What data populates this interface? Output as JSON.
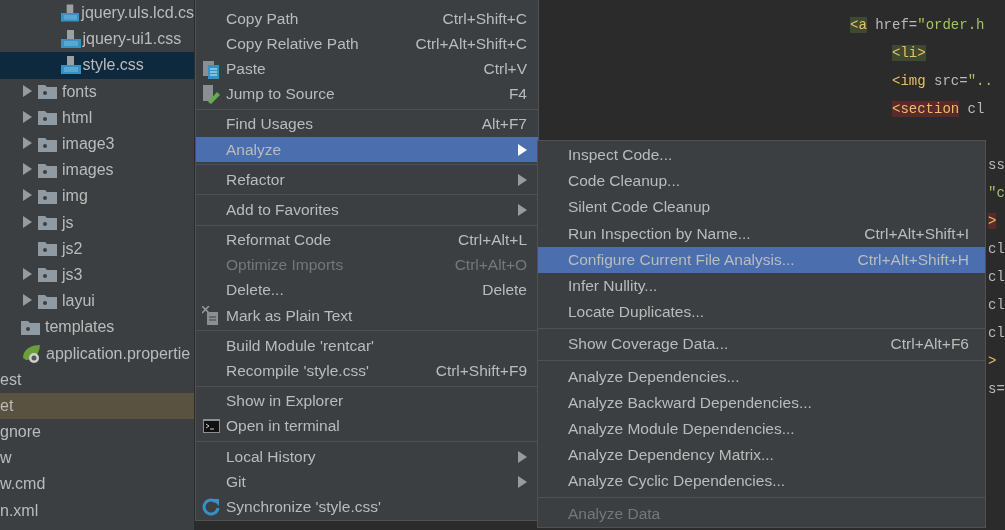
{
  "project_tree": [
    {
      "children": [
        {
          "children": [
            {
              "children": [
                {
                  "label": "jquery.uls.lcd.cs",
                  "kind": "css",
                  "selected": false,
                  "highlighted": false
                },
                {
                  "label": "jquery-ui1.css",
                  "kind": "css",
                  "selected": false,
                  "highlighted": false
                },
                {
                  "label": "style.css",
                  "kind": "css",
                  "selected": true,
                  "highlighted": false
                }
              ]
            },
            {
              "label": "fonts",
              "kind": "folder",
              "expanded": false,
              "selected": false,
              "highlighted": false
            },
            {
              "label": "html",
              "kind": "folder",
              "expanded": false,
              "selected": false,
              "highlighted": false
            },
            {
              "label": "image3",
              "kind": "folder",
              "expanded": false,
              "selected": false,
              "highlighted": false
            },
            {
              "label": "images",
              "kind": "folder",
              "expanded": false,
              "selected": false,
              "highlighted": false
            },
            {
              "label": "img",
              "kind": "folder",
              "expanded": false,
              "selected": false,
              "highlighted": false
            },
            {
              "label": "js",
              "kind": "folder",
              "expanded": false,
              "selected": false,
              "highlighted": false
            },
            {
              "label": "js2",
              "kind": "folder",
              "selected": false,
              "highlighted": false
            },
            {
              "label": "js3",
              "kind": "folder",
              "expanded": false,
              "selected": false,
              "highlighted": false
            },
            {
              "label": "layui",
              "kind": "folder",
              "expanded": false,
              "selected": false,
              "highlighted": false
            }
          ]
        },
        {
          "label": "templates",
          "kind": "folder",
          "selected": false,
          "highlighted": false
        },
        {
          "label": "application.propertie",
          "kind": "spring",
          "selected": false,
          "highlighted": false
        }
      ]
    },
    {
      "label": "est",
      "kind": "plain",
      "selected": false,
      "highlighted": false
    },
    {
      "label": "et",
      "kind": "plain",
      "selected": false,
      "highlighted": true
    },
    {
      "label": "gnore",
      "kind": "plain",
      "selected": false,
      "highlighted": false
    },
    {
      "label": "w",
      "kind": "plain",
      "selected": false,
      "highlighted": false
    },
    {
      "label": "w.cmd",
      "kind": "plain",
      "selected": false,
      "highlighted": false
    },
    {
      "label": "n.xml",
      "kind": "plain",
      "selected": false,
      "highlighted": false
    }
  ],
  "editor_lines": [
    {
      "kind": "child",
      "segments": [
        {
          "text": "<a",
          "kind": "tag",
          "matched": true,
          "error": false
        },
        {
          "text": " href=",
          "kind": "attr",
          "matched": false,
          "error": false
        },
        {
          "text": "\"order.h",
          "kind": "string",
          "matched": false,
          "error": false
        }
      ]
    },
    {
      "kind": "grandchild",
      "segments": [
        {
          "text": "<li>",
          "kind": "tag",
          "matched": true,
          "error": false
        }
      ]
    },
    {
      "kind": "grandchild",
      "segments": [
        {
          "text": "<img",
          "kind": "tag",
          "matched": false,
          "error": false
        },
        {
          "text": " src=",
          "kind": "attr",
          "matched": false,
          "error": false
        },
        {
          "text": "\"..",
          "kind": "string",
          "matched": false,
          "error": false
        }
      ]
    },
    {
      "kind": "grandchild",
      "segments": [
        {
          "text": "<section",
          "kind": "tag",
          "matched": false,
          "error": true
        },
        {
          "text": " cl",
          "kind": "attr",
          "matched": false,
          "error": false
        }
      ]
    },
    {
      "kind": "overflow",
      "segments": [
        {
          "text": "ss",
          "kind": "attr",
          "matched": false,
          "error": false
        }
      ]
    },
    {
      "kind": "overflow",
      "segments": [
        {
          "text": "\"c",
          "kind": "string",
          "matched": false,
          "error": false
        }
      ]
    },
    {
      "kind": "overflow",
      "segments": [
        {
          "text": ">",
          "kind": "tag",
          "matched": false,
          "error": true
        }
      ]
    },
    {
      "kind": "overflow",
      "segments": [
        {
          "text": "cl",
          "kind": "attr",
          "matched": false,
          "error": false
        }
      ]
    },
    {
      "kind": "overflow",
      "segments": [
        {
          "text": "cl",
          "kind": "attr",
          "matched": false,
          "error": false
        }
      ]
    },
    {
      "kind": "overflow",
      "segments": [
        {
          "text": "cl",
          "kind": "attr",
          "matched": false,
          "error": false
        }
      ]
    },
    {
      "kind": "overflow",
      "segments": [
        {
          "text": "cl",
          "kind": "attr",
          "matched": false,
          "error": false
        }
      ]
    },
    {
      "kind": "overflow",
      "segments": [
        {
          "text": ">",
          "kind": "tag",
          "matched": false,
          "error": false
        }
      ]
    },
    {
      "kind": "overflow",
      "segments": [
        {
          "text": "s=",
          "kind": "attr",
          "matched": false,
          "error": false
        }
      ]
    }
  ],
  "context_menu": [
    {
      "kind": "item",
      "label": "Copy Path",
      "shortcut": "Ctrl+Shift+C",
      "selected": false,
      "disabled": false
    },
    {
      "kind": "item",
      "label": "Copy Relative Path",
      "shortcut": "Ctrl+Alt+Shift+C",
      "selected": false,
      "disabled": false
    },
    {
      "kind": "item",
      "label": "Paste",
      "shortcut": "Ctrl+V",
      "selected": false,
      "disabled": false
    },
    {
      "kind": "item",
      "label": "Jump to Source",
      "shortcut": "F4",
      "selected": false,
      "disabled": false
    },
    {
      "kind": "separator"
    },
    {
      "kind": "item",
      "label": "Find Usages",
      "shortcut": "Alt+F7",
      "selected": false,
      "disabled": false
    },
    {
      "kind": "item",
      "label": "Analyze",
      "submenu": true,
      "selected": true,
      "disabled": false
    },
    {
      "kind": "separator"
    },
    {
      "kind": "item",
      "label": "Refactor",
      "submenu": true,
      "selected": false,
      "disabled": false
    },
    {
      "kind": "separator"
    },
    {
      "kind": "item",
      "label": "Add to Favorites",
      "submenu": true,
      "selected": false,
      "disabled": false
    },
    {
      "kind": "separator"
    },
    {
      "kind": "item",
      "label": "Reformat Code",
      "shortcut": "Ctrl+Alt+L",
      "selected": false,
      "disabled": false
    },
    {
      "kind": "item",
      "label": "Optimize Imports",
      "shortcut": "Ctrl+Alt+O",
      "selected": false,
      "disabled": true
    },
    {
      "kind": "item",
      "label": "Delete...",
      "shortcut": "Delete",
      "selected": false,
      "disabled": false
    },
    {
      "kind": "item",
      "label": "Mark as Plain Text",
      "selected": false,
      "disabled": false
    },
    {
      "kind": "separator"
    },
    {
      "kind": "item",
      "label": "Build Module 'rentcar'",
      "selected": false,
      "disabled": false
    },
    {
      "kind": "item",
      "label": "Recompile 'style.css'",
      "shortcut": "Ctrl+Shift+F9",
      "selected": false,
      "disabled": false
    },
    {
      "kind": "separator"
    },
    {
      "kind": "item",
      "label": "Show in Explorer",
      "selected": false,
      "disabled": false
    },
    {
      "kind": "item",
      "label": "Open in terminal",
      "selected": false,
      "disabled": false
    },
    {
      "kind": "separator"
    },
    {
      "kind": "item",
      "label": "Local History",
      "submenu": true,
      "selected": false,
      "disabled": false
    },
    {
      "kind": "item",
      "label": "Git",
      "submenu": true,
      "selected": false,
      "disabled": false
    },
    {
      "kind": "item",
      "label": "Synchronize 'style.css'",
      "selected": false,
      "disabled": false
    }
  ],
  "analyze_submenu": [
    {
      "kind": "item",
      "label": "Inspect Code...",
      "selected": false,
      "disabled": false
    },
    {
      "kind": "item",
      "label": "Code Cleanup...",
      "selected": false,
      "disabled": false
    },
    {
      "kind": "item",
      "label": "Silent Code Cleanup",
      "selected": false,
      "disabled": false
    },
    {
      "kind": "item",
      "label": "Run Inspection by Name...",
      "shortcut": "Ctrl+Alt+Shift+I",
      "selected": false,
      "disabled": false
    },
    {
      "kind": "item",
      "label": "Configure Current File Analysis...",
      "shortcut": "Ctrl+Alt+Shift+H",
      "selected": true,
      "disabled": false
    },
    {
      "kind": "item",
      "label": "Infer Nullity...",
      "selected": false,
      "disabled": false
    },
    {
      "kind": "item",
      "label": "Locate Duplicates...",
      "selected": false,
      "disabled": false
    },
    {
      "kind": "separator"
    },
    {
      "kind": "item",
      "label": "Show Coverage Data...",
      "shortcut": "Ctrl+Alt+F6",
      "selected": false,
      "disabled": false
    },
    {
      "kind": "separator"
    },
    {
      "kind": "item",
      "label": "Analyze Dependencies...",
      "selected": false,
      "disabled": false
    },
    {
      "kind": "item",
      "label": "Analyze Backward Dependencies...",
      "selected": false,
      "disabled": false
    },
    {
      "kind": "item",
      "label": "Analyze Module Dependencies...",
      "selected": false,
      "disabled": false
    },
    {
      "kind": "item",
      "label": "Analyze Dependency Matrix...",
      "selected": false,
      "disabled": false
    },
    {
      "kind": "item",
      "label": "Analyze Cyclic Dependencies...",
      "selected": false,
      "disabled": false
    },
    {
      "kind": "separator"
    },
    {
      "kind": "item",
      "label": "Analyze Data",
      "selected": false,
      "disabled": true
    }
  ]
}
